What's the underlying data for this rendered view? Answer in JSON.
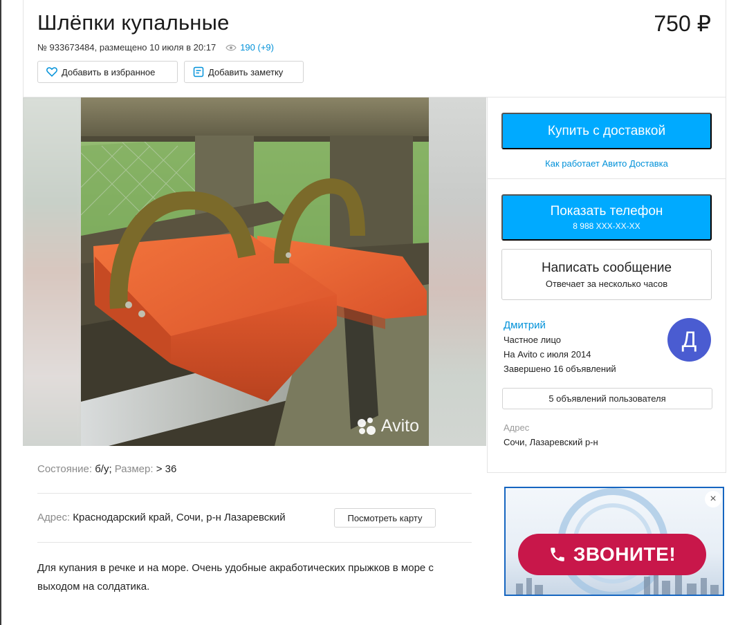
{
  "listing": {
    "title": "Шлёпки купальные",
    "price": "750 ₽",
    "meta_text": "№ 933673484, размещено 10 июля в 20:17",
    "views": "190 (+9)",
    "add_favorite": "Добавить в избранное",
    "add_note": "Добавить заметку"
  },
  "gallery": {
    "watermark": "Avito"
  },
  "details": {
    "condition_label": "Состояние:",
    "condition_value": "б/у;",
    "size_label": "Размер:",
    "size_value": "> 36"
  },
  "address": {
    "label": "Адрес:",
    "value": "Краснодарский край, Сочи, р-н Лазаревский",
    "map_button": "Посмотреть карту"
  },
  "description": "Для купания в речке и на море. Очень удобные акработических прыжков в море с выходом на солдатика.",
  "sidebar": {
    "buy_button": "Купить с доставкой",
    "delivery_link": "Как работает Авито Доставка",
    "phone_button": "Показать телефон",
    "phone_masked": "8 988 XXX-XX-XX",
    "message_button": "Написать сообщение",
    "message_sub": "Отвечает за несколько часов",
    "seller_name": "Дмитрий",
    "seller_type": "Частное лицо",
    "seller_since": "На Avito с июля 2014",
    "seller_completed": "Завершено 16 объявлений",
    "avatar_letter": "Д",
    "user_ads_button": "5 объявлений пользователя",
    "address_label": "Адрес",
    "address_value": "Сочи, Лазаревский р-н"
  },
  "ad": {
    "call_label": "ЗВОНИТЕ!",
    "close": "×"
  },
  "colors": {
    "accent": "#00aaff",
    "link": "#0091d9",
    "avatar": "#4a5cd1",
    "ad_button": "#c8174a"
  },
  "icons": [
    "heart-icon",
    "note-icon",
    "eye-icon",
    "avito-logo-icon",
    "phone-icon",
    "close-icon"
  ]
}
